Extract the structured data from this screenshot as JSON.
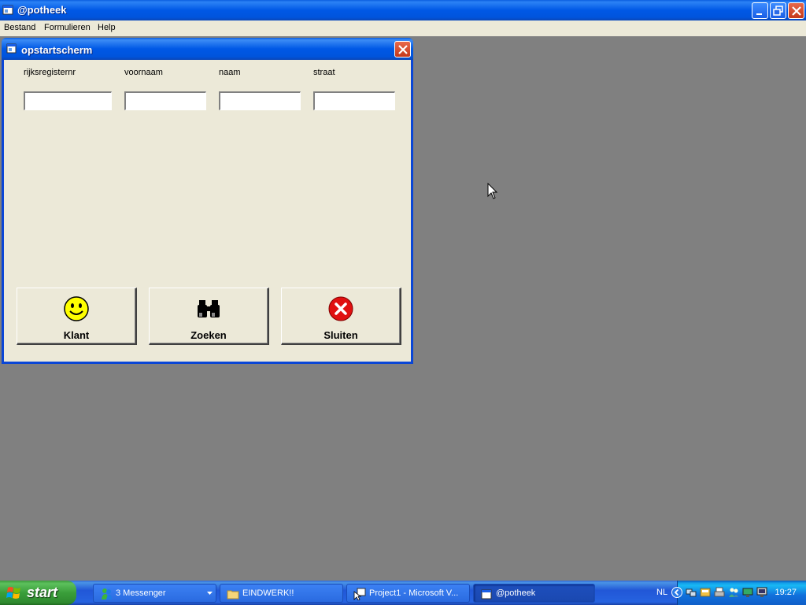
{
  "app": {
    "title": "@potheek"
  },
  "menu": {
    "items": [
      "Bestand",
      "Formulieren",
      "Help"
    ]
  },
  "child_window": {
    "title": "opstartscherm",
    "fields": [
      {
        "label": "rijksregisternr",
        "value": "",
        "placeholder": ""
      },
      {
        "label": "voornaam",
        "value": "",
        "placeholder": ""
      },
      {
        "label": "naam",
        "value": "",
        "placeholder": ""
      },
      {
        "label": "straat",
        "value": "",
        "placeholder": ""
      }
    ],
    "buttons": [
      {
        "label": "Klant",
        "icon": "smiley-icon"
      },
      {
        "label": "Zoeken",
        "icon": "binoculars-icon"
      },
      {
        "label": "Sluiten",
        "icon": "close-circle-icon"
      }
    ]
  },
  "taskbar": {
    "start_label": "start",
    "tasks": [
      {
        "label": "3 Messenger",
        "icon": "messenger-icon"
      },
      {
        "label": "EINDWERK!!",
        "icon": "folder-icon"
      },
      {
        "label": "Project1 - Microsoft V...",
        "icon": "vb-project-icon"
      },
      {
        "label": "@potheek",
        "icon": "app-icon"
      }
    ],
    "language": "NL",
    "clock": "19:27"
  },
  "colors": {
    "desktop_bg": "#808080",
    "form_bg": "#ece9d8",
    "titlebar_blue": "#0054dc"
  }
}
